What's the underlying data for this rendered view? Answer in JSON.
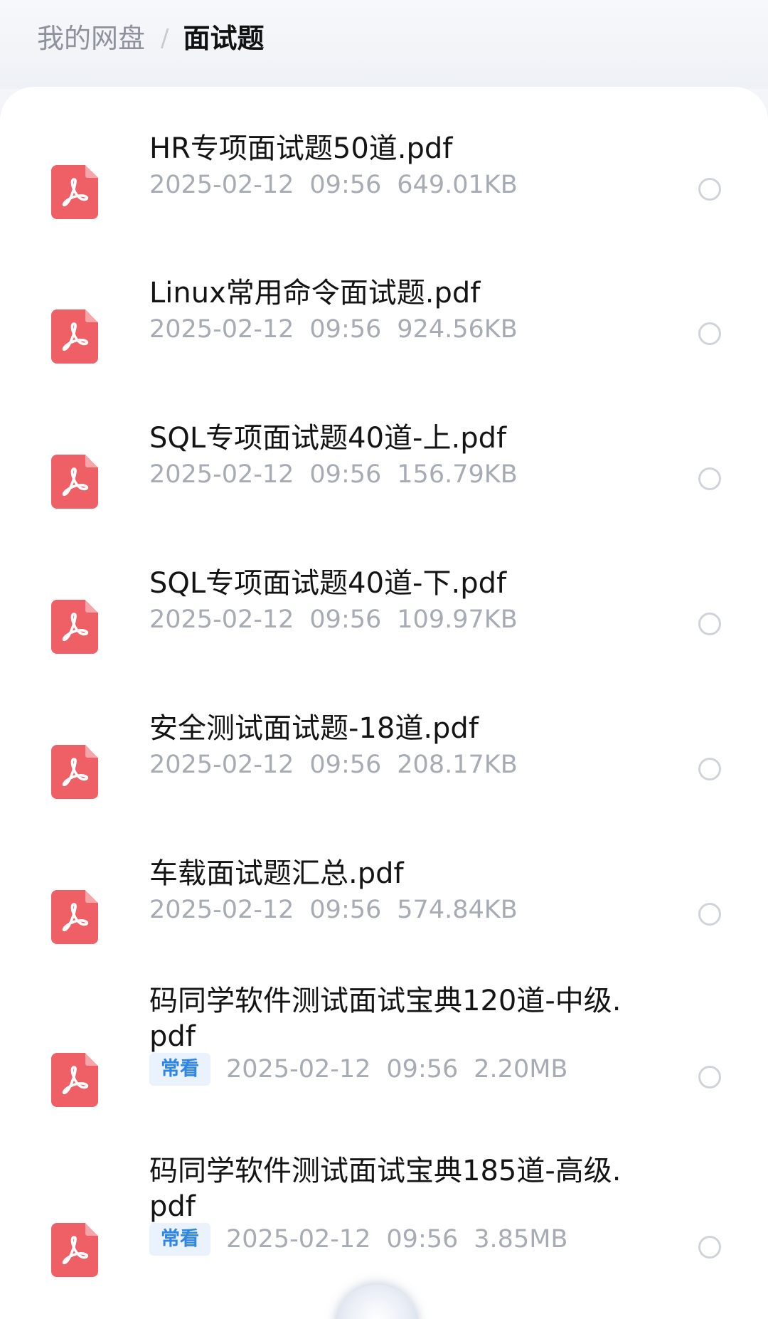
{
  "breadcrumb": {
    "root": "我的网盘",
    "separator": "/",
    "current": "面试题"
  },
  "files": [
    {
      "name": "HR专项面试题50道.pdf",
      "date": "2025-02-12",
      "time": "09:56",
      "size": "649.01KB",
      "tag": ""
    },
    {
      "name": "Linux常用命令面试题.pdf",
      "date": "2025-02-12",
      "time": "09:56",
      "size": "924.56KB",
      "tag": ""
    },
    {
      "name": "SQL专项面试题40道-上.pdf",
      "date": "2025-02-12",
      "time": "09:56",
      "size": "156.79KB",
      "tag": ""
    },
    {
      "name": "SQL专项面试题40道-下.pdf",
      "date": "2025-02-12",
      "time": "09:56",
      "size": "109.97KB",
      "tag": ""
    },
    {
      "name": "安全测试面试题-18道.pdf",
      "date": "2025-02-12",
      "time": "09:56",
      "size": "208.17KB",
      "tag": ""
    },
    {
      "name": "车载面试题汇总.pdf",
      "date": "2025-02-12",
      "time": "09:56",
      "size": "574.84KB",
      "tag": ""
    },
    {
      "name": "码同学软件测试面试宝典120道-中级.pdf",
      "date": "2025-02-12",
      "time": "09:56",
      "size": "2.20MB",
      "tag": "常看"
    },
    {
      "name": "码同学软件测试面试宝典185道-高级.pdf",
      "date": "2025-02-12",
      "time": "09:56",
      "size": "3.85MB",
      "tag": "常看"
    }
  ],
  "icons": {
    "file": "pdf-file-icon",
    "select": "radio-circle-icon"
  },
  "colors": {
    "pdf_red": "#ef5f66",
    "tag_blue": "#2d86e6",
    "meta_gray": "#a6abb4"
  }
}
